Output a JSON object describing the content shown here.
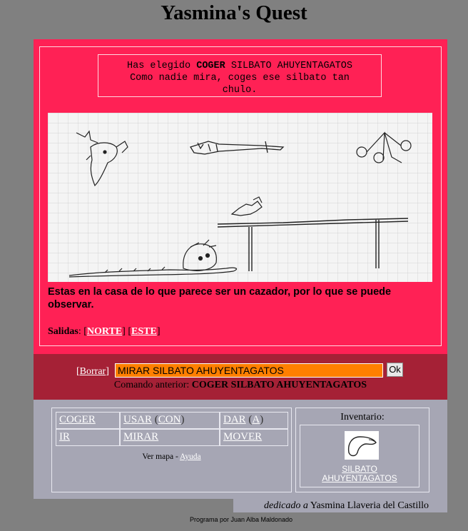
{
  "title": "Yasmina's Quest",
  "message": {
    "prefix": "Has elegido",
    "command": "COGER",
    "object": "SILBATO AHUYENTAGATOS",
    "line2": "Como nadie mira, coges ese silbato tan",
    "line3": "chulo."
  },
  "description": "Estas en la casa de lo que parece ser un cazador, por lo que se puede observar.",
  "exits": {
    "label": "Salidas",
    "items": [
      "NORTE",
      "ESTE"
    ]
  },
  "command_bar": {
    "clear_label": "Borrar",
    "input_value": "MIRAR SILBATO AHUYENTAGATOS",
    "ok_label": "Ok",
    "previous_label": "Comando anterior:",
    "previous_value": "COGER SILBATO AHUYENTAGATOS"
  },
  "verbs": {
    "coger": "COGER",
    "usar": "USAR",
    "con": "CON",
    "dar": "DAR",
    "a": "A",
    "ir": "IR",
    "mirar": "MIRAR",
    "mover": "MOVER",
    "map_label": "Ver mapa -",
    "help_label": "Ayuda"
  },
  "inventory": {
    "title": "Inventario:",
    "item_line1": "SILBATO",
    "item_line2": "AHUYENTAGATOS"
  },
  "dedication": {
    "prefix": "dedicado a",
    "name": "Yasmina Llaveria del Castillo"
  },
  "credit": "Programa por Juan Alba Maldonado",
  "colors": {
    "page_bg": "#808080",
    "panel_bg": "#ff2155",
    "command_bar_bg": "#a52136",
    "actions_bg": "#a6a6b4",
    "input_bg": "#ff7f00"
  }
}
